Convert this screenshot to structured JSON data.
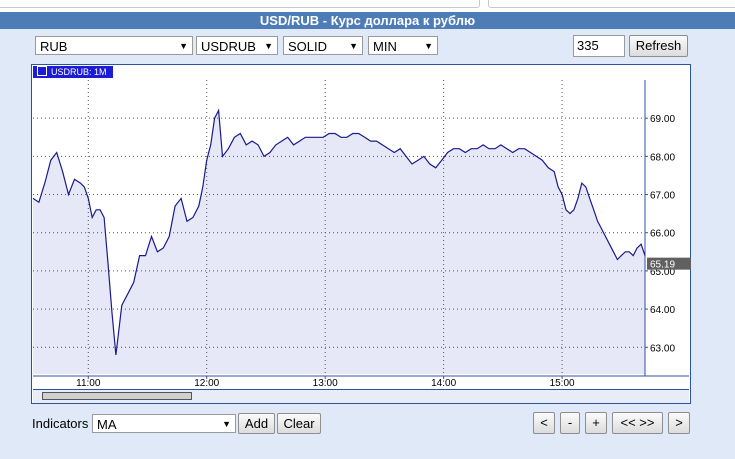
{
  "window": {
    "title": "USD/RUB - Курс доллара к рублю"
  },
  "toolbar": {
    "currency_select": "RUB",
    "pair_select": "USDRUB",
    "style_select": "SOLID",
    "period_select": "MIN",
    "count_input": "335",
    "refresh_label": "Refresh"
  },
  "legend": {
    "label": "USDRUB: 1M"
  },
  "indicators": {
    "label": "Indicators",
    "select": "MA",
    "add_label": "Add",
    "clear_label": "Clear"
  },
  "nav": {
    "back": "<",
    "zoom_out": "-",
    "zoom_in": "+",
    "fit": "<< >>",
    "forward": ">"
  },
  "colors": {
    "line": "#1a1a8c",
    "fill": "#e6e8f8",
    "last_tag": "#606060",
    "accent": "#4e7cb7"
  },
  "chart_data": {
    "type": "area",
    "series_label": "USDRUB: 1M",
    "last_value": "65.19",
    "ylim": [
      62.3,
      70.0
    ],
    "xlim": [
      "10:32",
      "15:42"
    ],
    "x_ticks": [
      "11:00",
      "12:00",
      "13:00",
      "14:00",
      "15:00"
    ],
    "y_ticks": [
      "63.00",
      "64.00",
      "65.00",
      "66.00",
      "67.00",
      "68.00",
      "69.00"
    ],
    "grid": true,
    "x": [
      "10:32",
      "10:35",
      "10:38",
      "10:41",
      "10:44",
      "10:47",
      "10:50",
      "10:53",
      "10:56",
      "10:58",
      "11:00",
      "11:02",
      "11:04",
      "11:06",
      "11:08",
      "11:10",
      "11:12",
      "11:14",
      "11:17",
      "11:20",
      "11:23",
      "11:26",
      "11:29",
      "11:32",
      "11:35",
      "11:38",
      "11:41",
      "11:44",
      "11:47",
      "11:50",
      "11:53",
      "11:56",
      "11:58",
      "12:00",
      "12:02",
      "12:04",
      "12:06",
      "12:08",
      "12:11",
      "12:14",
      "12:17",
      "12:20",
      "12:23",
      "12:26",
      "12:29",
      "12:32",
      "12:35",
      "12:38",
      "12:41",
      "12:44",
      "12:47",
      "12:50",
      "12:53",
      "12:56",
      "12:59",
      "13:02",
      "13:05",
      "13:08",
      "13:11",
      "13:14",
      "13:17",
      "13:20",
      "13:23",
      "13:26",
      "13:29",
      "13:32",
      "13:35",
      "13:38",
      "13:41",
      "13:44",
      "13:47",
      "13:50",
      "13:53",
      "13:56",
      "13:59",
      "14:02",
      "14:05",
      "14:08",
      "14:11",
      "14:14",
      "14:17",
      "14:20",
      "14:23",
      "14:26",
      "14:29",
      "14:32",
      "14:35",
      "14:38",
      "14:41",
      "14:44",
      "14:47",
      "14:50",
      "14:53",
      "14:56",
      "14:58",
      "15:00",
      "15:02",
      "15:04",
      "15:06",
      "15:08",
      "15:10",
      "15:12",
      "15:14",
      "15:16",
      "15:18",
      "15:20",
      "15:22",
      "15:24",
      "15:26",
      "15:28",
      "15:30",
      "15:32",
      "15:34",
      "15:36",
      "15:38",
      "15:40",
      "15:42"
    ],
    "y": [
      66.9,
      66.8,
      67.3,
      67.9,
      68.1,
      67.6,
      67.0,
      67.4,
      67.3,
      67.2,
      66.9,
      66.4,
      66.6,
      66.6,
      66.4,
      65.2,
      63.9,
      62.8,
      64.1,
      64.4,
      64.7,
      65.4,
      65.4,
      65.9,
      65.5,
      65.6,
      65.9,
      66.7,
      66.9,
      66.3,
      66.4,
      66.7,
      67.2,
      67.9,
      68.3,
      69.0,
      69.2,
      68.0,
      68.2,
      68.5,
      68.6,
      68.3,
      68.4,
      68.3,
      68.0,
      68.1,
      68.3,
      68.4,
      68.5,
      68.3,
      68.4,
      68.5,
      68.5,
      68.5,
      68.5,
      68.6,
      68.6,
      68.5,
      68.5,
      68.6,
      68.6,
      68.5,
      68.4,
      68.4,
      68.3,
      68.2,
      68.1,
      68.2,
      68.0,
      67.8,
      67.9,
      68.0,
      67.8,
      67.7,
      67.9,
      68.1,
      68.2,
      68.2,
      68.1,
      68.2,
      68.2,
      68.3,
      68.2,
      68.2,
      68.3,
      68.2,
      68.1,
      68.2,
      68.2,
      68.1,
      68.0,
      67.9,
      67.7,
      67.6,
      67.2,
      67.0,
      66.6,
      66.5,
      66.6,
      66.9,
      67.3,
      67.2,
      66.9,
      66.6,
      66.3,
      66.1,
      65.9,
      65.7,
      65.5,
      65.3,
      65.4,
      65.5,
      65.5,
      65.4,
      65.6,
      65.7,
      65.4
    ]
  }
}
